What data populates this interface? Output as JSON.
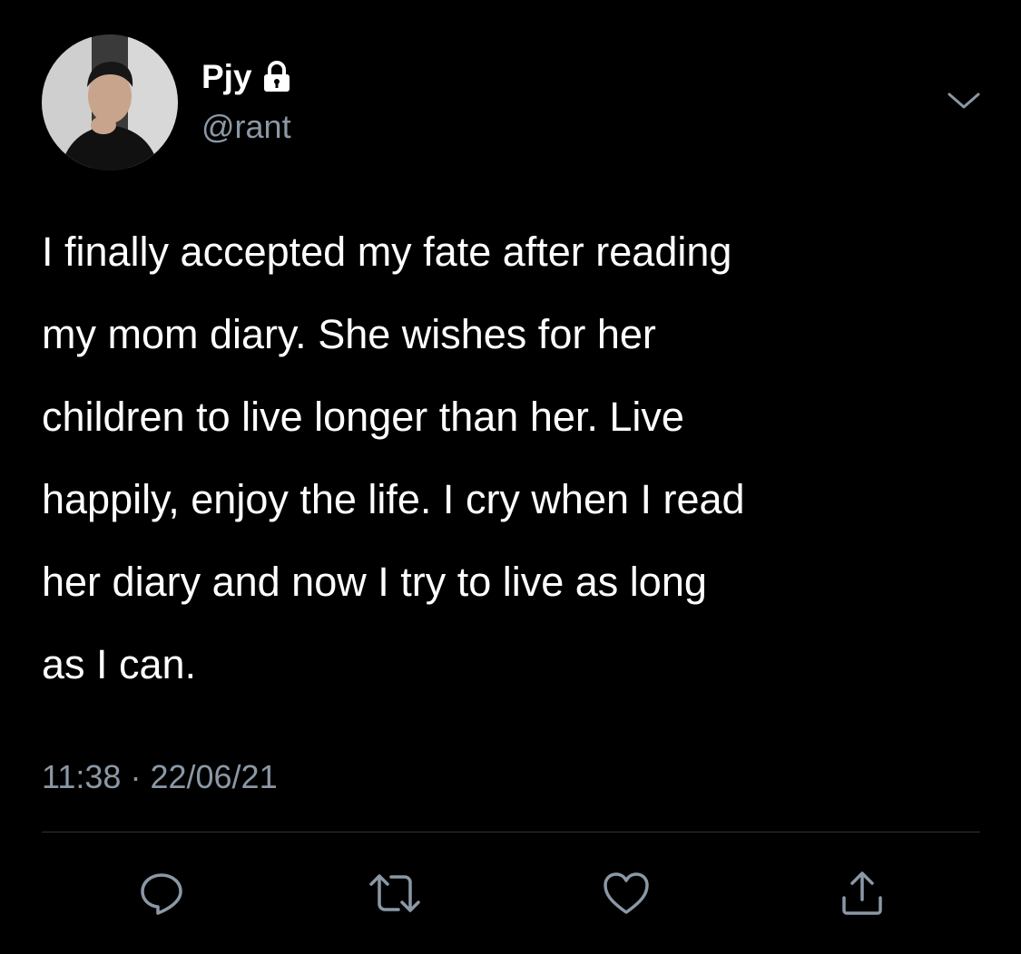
{
  "tweet": {
    "display_name": "Pjy",
    "handle": "@rant",
    "protected_icon": "lock-icon",
    "menu_icon": "chevron-down-icon",
    "text": "I finally accepted my fate after reading\nmy mom diary. She wishes for her\nchildren to live longer than her. Live\nhappily, enjoy the life. I cry when I read\nher diary and now I try to live as long\nas I can.",
    "time": "11:38",
    "separator": "·",
    "date": "22/06/21"
  },
  "actions": [
    {
      "name": "reply",
      "icon": "reply-icon"
    },
    {
      "name": "retweet",
      "icon": "retweet-icon"
    },
    {
      "name": "like",
      "icon": "heart-icon"
    },
    {
      "name": "share",
      "icon": "share-icon"
    }
  ],
  "colors": {
    "background": "#000000",
    "text_primary": "#ffffff",
    "text_secondary": "#8b98a5",
    "divider": "#2f3336",
    "icon": "#8b98a5"
  }
}
